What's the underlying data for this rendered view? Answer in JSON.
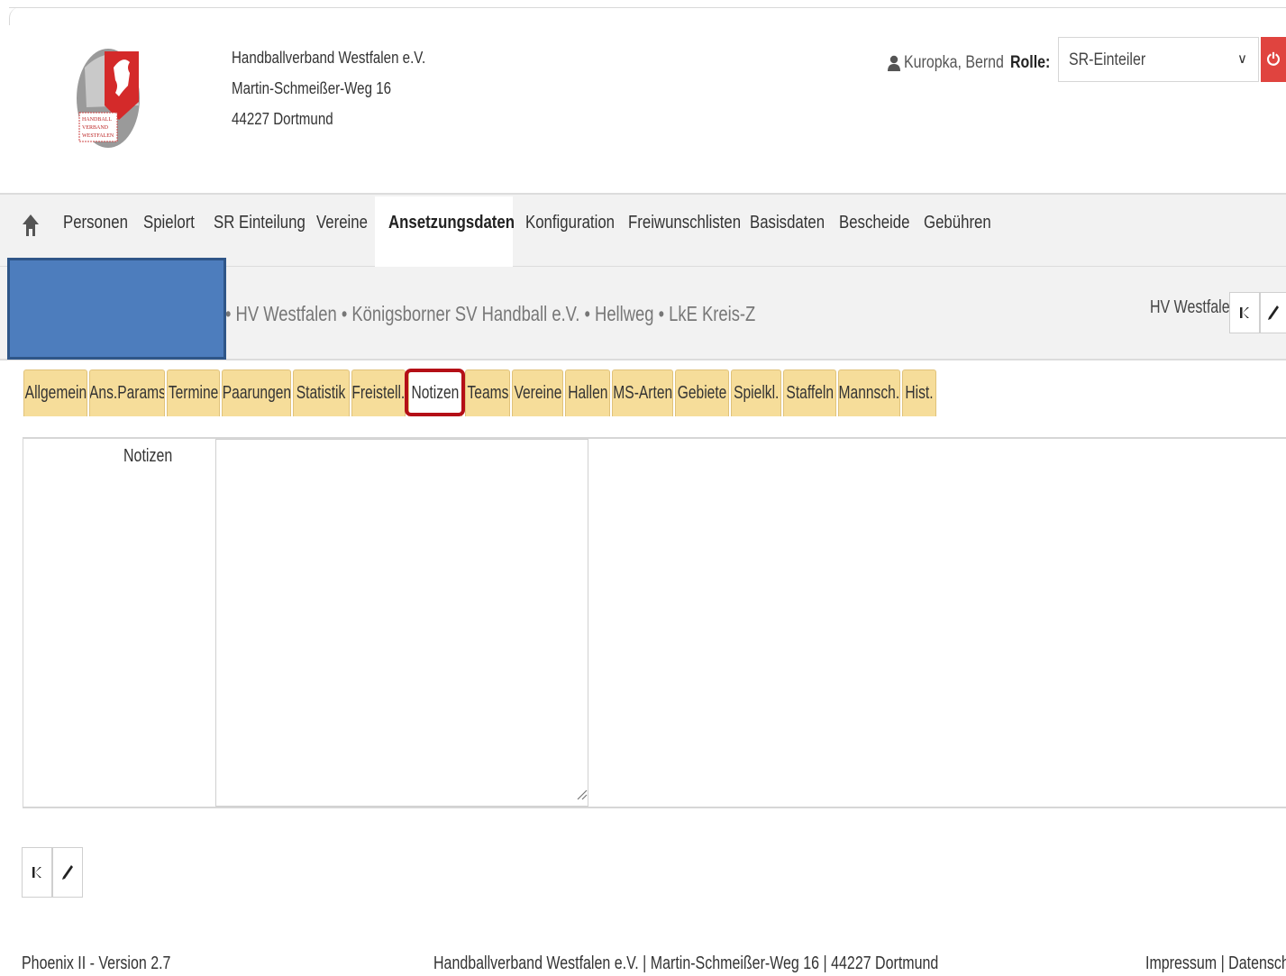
{
  "org": {
    "name": "Handballverband Westfalen e.V.",
    "street": "Martin-Schmeißer-Weg 16",
    "city": "44227 Dortmund",
    "logo_text": [
      "HANDBALL",
      "VERBAND",
      "WESTFALEN"
    ]
  },
  "user": {
    "icon": "user-icon",
    "name": "Kuropka, Bernd",
    "role_label": "Rolle:",
    "role_value": "SR-Einteiler",
    "logout_icon": "power-icon"
  },
  "nav": {
    "home_icon": "home-icon",
    "items": [
      "Personen",
      "Spielort",
      "SR Einteilung",
      "Vereine",
      "Ansetzungsdaten",
      "Konfiguration",
      "Freiwunschlisten",
      "Basisdaten",
      "Bescheide",
      "Gebühren"
    ],
    "active": "Ansetzungsdaten"
  },
  "breadcrumb": {
    "path": "• HV Westfalen • Königsborner SV Handball e.V. • Hellweg •   LkE Kreis-Z",
    "scope": "HV Westfalen"
  },
  "tabs": {
    "items": [
      "Allgemein",
      "Ans.Params",
      "Termine",
      "Paarungen",
      "Statistik",
      "Freistell.",
      "Notizen",
      "Teams",
      "Vereine",
      "Hallen",
      "MS-Arten",
      "Gebiete",
      "Spielkl.",
      "Staffeln",
      "Mannsch.",
      "Hist."
    ],
    "active": "Notizen"
  },
  "panel": {
    "notes_label": "Notizen",
    "notes_value": ""
  },
  "footer": {
    "version": "Phoenix II - Version 2.7",
    "address": "Handballverband Westfalen e.V. | Martin-Schmeißer-Weg 16 | 44227 Dortmund",
    "links": "Impressum | Datenschutz"
  },
  "colors": {
    "tab_bg": "#f6dd9a",
    "highlight": "#b40f16",
    "redaction": "#4d7dbd",
    "logout_bg": "#e0443f"
  }
}
